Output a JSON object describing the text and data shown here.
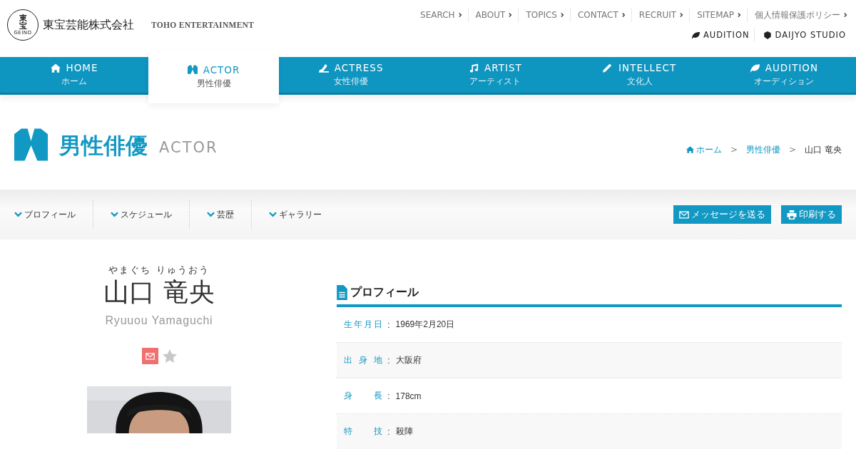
{
  "logo": {
    "mark_top": "東宝",
    "mark_ring": "GEINO",
    "name": "東宝芸能株式会社",
    "english": "TOHO ENTERTAINMENT"
  },
  "top_links": [
    "SEARCH",
    "ABOUT",
    "TOPICS",
    "CONTACT",
    "RECRUIT",
    "SITEMAP",
    "個人情報保護ポリシー"
  ],
  "sub_links": [
    {
      "kind": "leaf",
      "label": "AUDITION"
    },
    {
      "kind": "cube",
      "label": "DAIJYO STUDIO"
    }
  ],
  "nav": [
    {
      "kind": "home",
      "label": "HOME",
      "sub": "ホーム",
      "selected": false
    },
    {
      "kind": "jacket",
      "label": "ACTOR",
      "sub": "男性俳優",
      "selected": true
    },
    {
      "kind": "shoe",
      "label": "ACTRESS",
      "sub": "女性俳優",
      "selected": false
    },
    {
      "kind": "music",
      "label": "ARTIST",
      "sub": "アーティスト",
      "selected": false
    },
    {
      "kind": "pencil",
      "label": "INTELLECT",
      "sub": "文化人",
      "selected": false
    },
    {
      "kind": "leaf",
      "label": "AUDITION",
      "sub": "オーディション",
      "selected": false
    }
  ],
  "page_title": {
    "ja": "男性俳優",
    "en": "ACTOR"
  },
  "breadcrumb": [
    {
      "kind": "link",
      "text": "ホーム"
    },
    {
      "kind": "separator",
      "text": ">"
    },
    {
      "kind": "link",
      "text": "男性俳優"
    },
    {
      "kind": "separator",
      "text": ">"
    },
    {
      "kind": "current",
      "text": "山口 竜央"
    }
  ],
  "section_tabs": [
    "プロフィール",
    "スケジュール",
    "芸歴",
    "ギャラリー"
  ],
  "actions": [
    {
      "kind": "mail",
      "label": "メッセージを送る"
    },
    {
      "kind": "print",
      "label": "印刷する"
    }
  ],
  "person": {
    "reading": "やまぐち りゅうおう",
    "name": "山口 竜央",
    "romaji": "Ryuuou Yamaguchi",
    "favorite": false
  },
  "profile": {
    "heading": "プロフィール",
    "rows": [
      {
        "label": "生年月日",
        "delimiter": ":",
        "value": "1969年2月20日"
      },
      {
        "label": "出身地",
        "delimiter": ":",
        "value": "大阪府"
      },
      {
        "label": "身長",
        "delimiter": ":",
        "value": "178cm"
      },
      {
        "label": "特技",
        "delimiter": ":",
        "value": "殺陣"
      }
    ]
  }
}
